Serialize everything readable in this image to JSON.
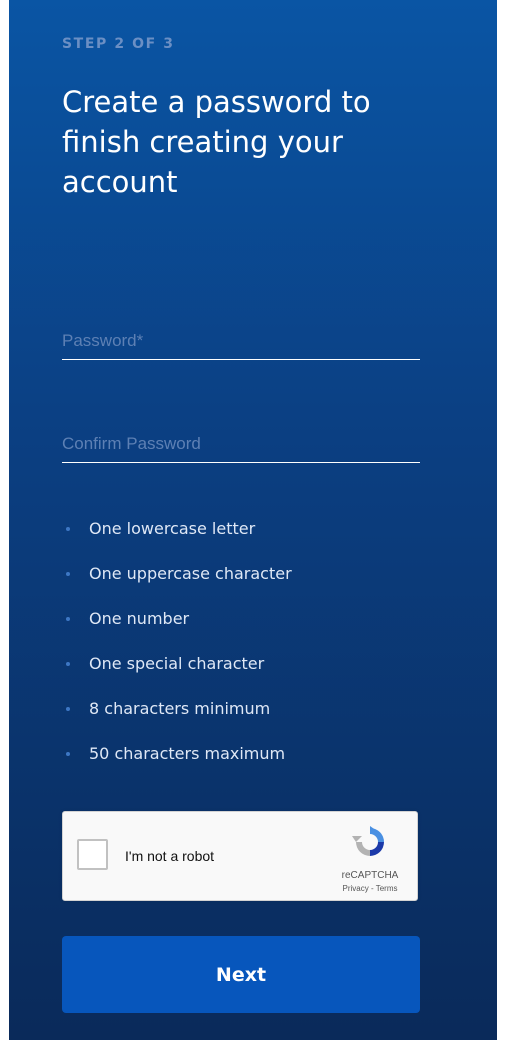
{
  "step": {
    "label": "STEP 2 OF 3"
  },
  "heading": "Create a password to finish creating your account",
  "password_field": {
    "placeholder": "Password*",
    "value": ""
  },
  "confirm_field": {
    "placeholder": "Confirm Password",
    "value": ""
  },
  "requirements": [
    "One lowercase letter",
    "One uppercase character",
    "One number",
    "One special character",
    "8 characters minimum",
    "50 characters maximum"
  ],
  "captcha": {
    "label": "I'm not a robot",
    "brand": "reCAPTCHA",
    "privacy": "Privacy",
    "separator": " - ",
    "terms": "Terms",
    "checked": false
  },
  "next_button": {
    "label": "Next"
  },
  "colors": {
    "background_top": "#0a55a4",
    "background_bottom": "#0a2a5a",
    "button": "#0756bc",
    "bullet": "#3d77c4"
  }
}
